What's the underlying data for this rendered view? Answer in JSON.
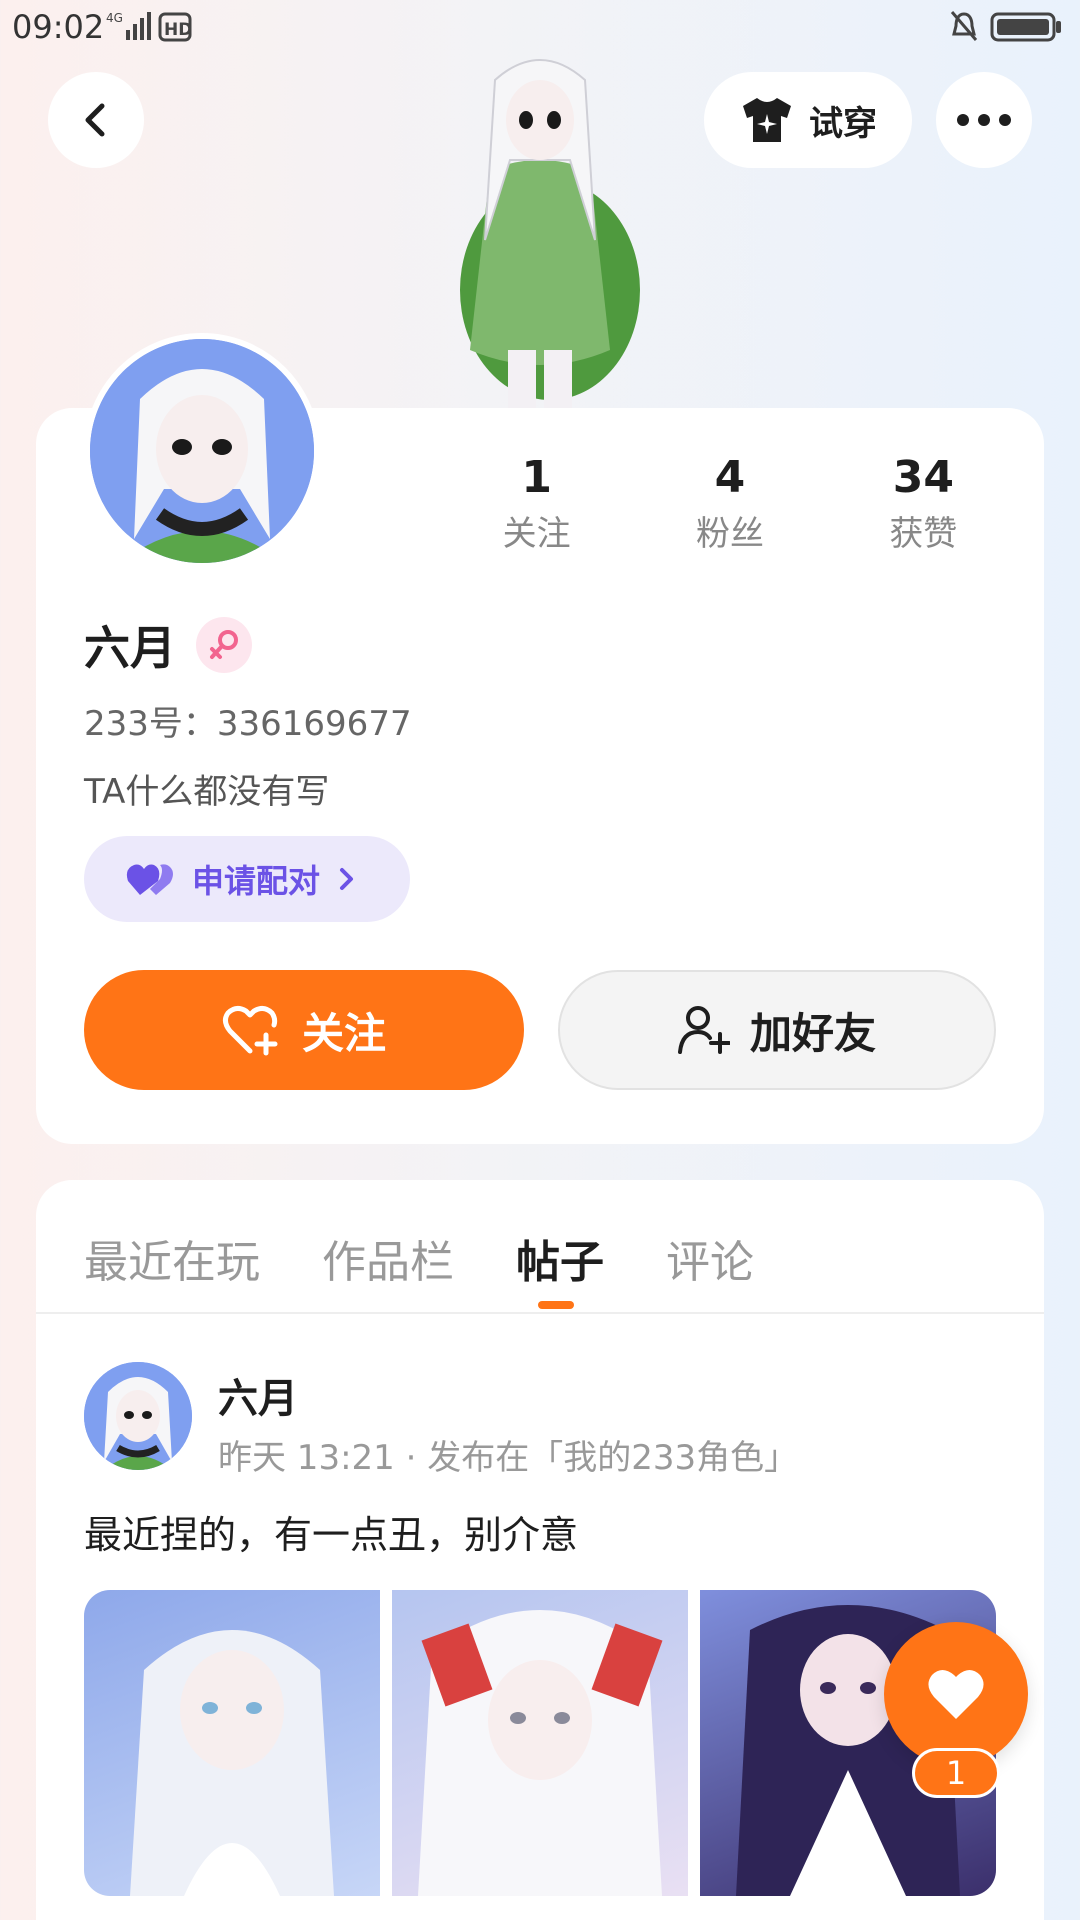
{
  "status_bar": {
    "time": "09:02",
    "network_icons": [
      "4g-signal-icon",
      "hd-icon"
    ],
    "right_icons": [
      "mute-bell-icon",
      "battery-icon"
    ]
  },
  "header": {
    "back_icon": "chevron-left-icon",
    "tryon_label": "试穿",
    "tryon_icon": "tshirt-icon",
    "more_icon": "more-dots-icon"
  },
  "profile": {
    "name": "六月",
    "gender_icon": "female-icon",
    "id_text": "233号：336169677",
    "bio": "TA什么都没有写",
    "pair_label": "申请配对",
    "pair_icon": "double-heart-icon",
    "stats": [
      {
        "num": "1",
        "label": "关注"
      },
      {
        "num": "4",
        "label": "粉丝"
      },
      {
        "num": "34",
        "label": "获赞"
      }
    ],
    "follow_label": "关注",
    "add_friend_label": "加好友"
  },
  "tabs": [
    {
      "label": "最近在玩"
    },
    {
      "label": "作品栏"
    },
    {
      "label": "帖子"
    },
    {
      "label": "评论"
    }
  ],
  "active_tab": "帖子",
  "post": {
    "author": "六月",
    "meta": "昨天 13:21 · 发布在「我的233角色」",
    "text": "最近捏的，有一点丑，别介意"
  },
  "like_fab": {
    "count": "1"
  },
  "colors": {
    "accent": "#ff7416",
    "pair_purple": "#6b52e6"
  }
}
